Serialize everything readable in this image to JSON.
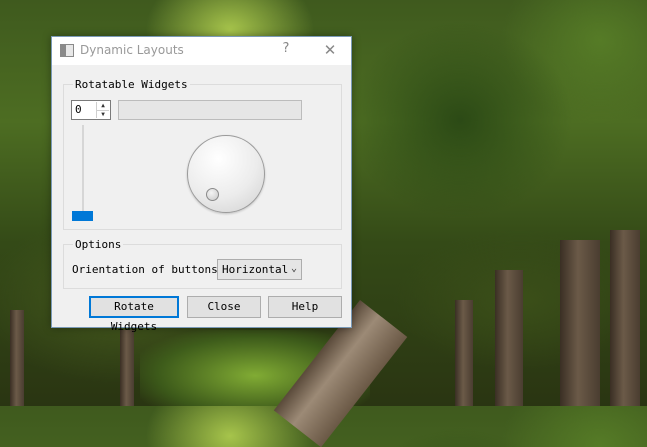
{
  "window": {
    "title": "Dynamic Layouts",
    "help_glyph": "?",
    "close_glyph": "✕"
  },
  "rotatable_group": {
    "title": "Rotatable Widgets",
    "spinbox_value": "0",
    "progress_value": 0,
    "slider_value": 0,
    "dial_value": 0
  },
  "options_group": {
    "title": "Options",
    "orientation_label": "Orientation of buttons:",
    "orientation_value": "Horizontal"
  },
  "buttons": {
    "rotate": "Rotate Widgets",
    "close": "Close",
    "help": "Help"
  },
  "colors": {
    "accent": "#0078d7"
  }
}
